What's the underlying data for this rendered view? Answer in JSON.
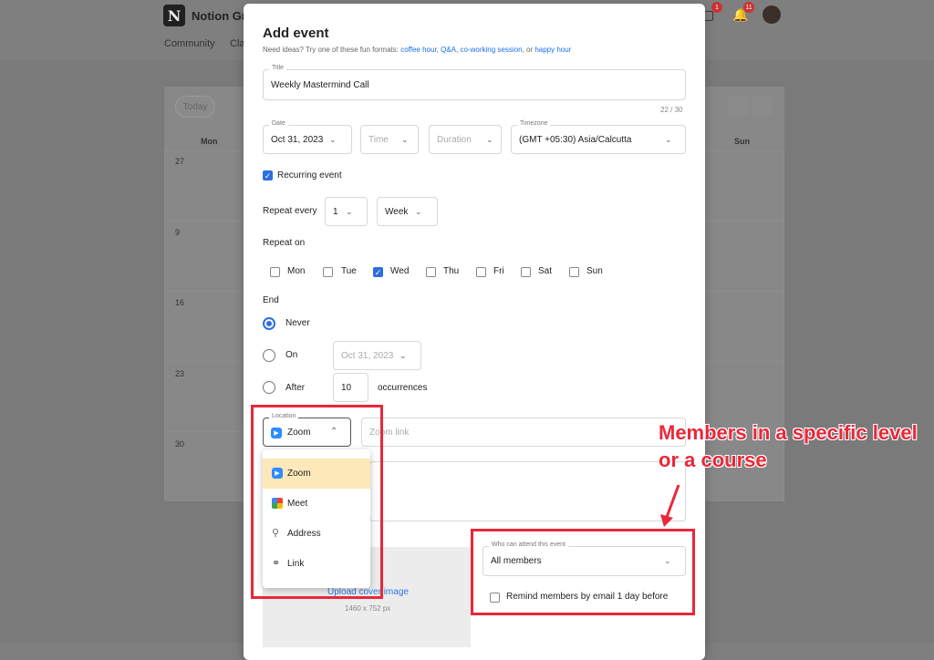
{
  "background": {
    "brand": "Notion Gro",
    "nav": [
      "Community",
      "Cla"
    ],
    "today_label": "Today",
    "days": [
      "Mon",
      "Sun"
    ],
    "dates": [
      "27",
      "9",
      "16",
      "23",
      "30"
    ],
    "badges": [
      "1",
      "11"
    ]
  },
  "modal": {
    "title": "Add event",
    "ideas_prefix": "Need ideas? Try one of these fun formats:",
    "ideas_links": [
      "coffee hour",
      "Q&A",
      "co-working session"
    ],
    "ideas_or": ", or",
    "ideas_last": "happy hour",
    "title_field": {
      "label": "Title",
      "value": "Weekly Mastermind Call",
      "counter": "22 / 30"
    },
    "date_field": {
      "label": "Date",
      "value": "Oct 31, 2023"
    },
    "time_field": {
      "placeholder": "Time"
    },
    "duration_field": {
      "placeholder": "Duration"
    },
    "timezone_field": {
      "label": "Timezone",
      "value": "(GMT +05:30) Asia/Calcutta"
    },
    "recurring": {
      "label": "Recurring event",
      "checked": true
    },
    "repeat_every": {
      "label": "Repeat every",
      "count": "1",
      "unit": "Week"
    },
    "repeat_on": {
      "label": "Repeat on",
      "days": [
        {
          "label": "Mon",
          "checked": false
        },
        {
          "label": "Tue",
          "checked": false
        },
        {
          "label": "Wed",
          "checked": true
        },
        {
          "label": "Thu",
          "checked": false
        },
        {
          "label": "Fri",
          "checked": false
        },
        {
          "label": "Sat",
          "checked": false
        },
        {
          "label": "Sun",
          "checked": false
        }
      ]
    },
    "end": {
      "label": "End",
      "never": "Never",
      "on": "On",
      "on_date": "Oct 31, 2023",
      "after": "After",
      "after_count": "10",
      "occurrences": "occurrences",
      "selected": "Never"
    },
    "location": {
      "label": "Location",
      "value": "Zoom",
      "link_placeholder": "Zoom link",
      "options": [
        {
          "label": "Zoom",
          "icon": "zoom-icon"
        },
        {
          "label": "Meet",
          "icon": "meet-icon"
        },
        {
          "label": "Address",
          "icon": "pin-icon"
        },
        {
          "label": "Link",
          "icon": "link-icon"
        }
      ]
    },
    "cover": {
      "upload": "Upload cover image",
      "dims": "1460 x 752 px"
    },
    "attend": {
      "label": "Who can attend this event",
      "value": "All members"
    },
    "remind": {
      "label": "Remind members by email 1 day before",
      "checked": false
    }
  },
  "annotation": {
    "text": "Members in a specific level or a course",
    "color": "#e8283a"
  }
}
